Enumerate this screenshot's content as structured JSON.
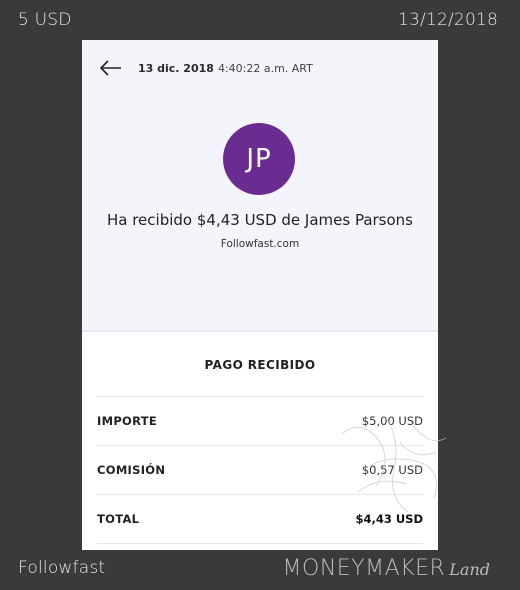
{
  "frame": {
    "amount_label": "5 USD",
    "date_label": "13/12/2018",
    "source_label": "Followfast",
    "brand": {
      "main": "MONEYMAKER",
      "suffix": "Land"
    }
  },
  "header": {
    "date": "13 dic. 2018",
    "time": "4:40:22 a.m. ART",
    "back_icon": "arrow-left-icon"
  },
  "payer": {
    "initials": "JP",
    "avatar_color": "#6a2c91",
    "title": "Ha recibido $4,43 USD de James Parsons",
    "merchant": "Followfast.com"
  },
  "details": {
    "title": "PAGO RECIBIDO",
    "rows": [
      {
        "label": "IMPORTE",
        "value": "$5,00 USD"
      },
      {
        "label": "COMISIÓN",
        "value": "$0,57 USD"
      },
      {
        "label": "TOTAL",
        "value": "$4,43 USD"
      }
    ]
  }
}
